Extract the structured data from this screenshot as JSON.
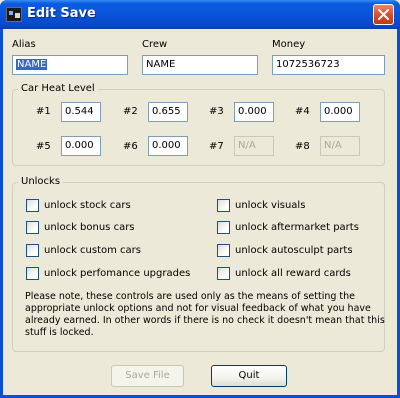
{
  "window": {
    "title": "Edit Save",
    "app_icon": "nfs-app-icon",
    "close_icon": "close-icon",
    "close_color": "#d9512c",
    "titlebar_color": "#0a54d8"
  },
  "alias": {
    "label": "Alias",
    "value": "NAME"
  },
  "crew": {
    "label": "Crew",
    "value": "NAME"
  },
  "money": {
    "label": "Money",
    "value": "1072536723"
  },
  "heat": {
    "title": "Car Heat Level",
    "items": [
      {
        "label": "#1",
        "value": "0.544",
        "enabled": true
      },
      {
        "label": "#2",
        "value": "0.655",
        "enabled": true
      },
      {
        "label": "#3",
        "value": "0.000",
        "enabled": true
      },
      {
        "label": "#4",
        "value": "0.000",
        "enabled": true
      },
      {
        "label": "#5",
        "value": "0.000",
        "enabled": true
      },
      {
        "label": "#6",
        "value": "0.000",
        "enabled": true
      },
      {
        "label": "#7",
        "value": "N/A",
        "enabled": false
      },
      {
        "label": "#8",
        "value": "N/A",
        "enabled": false
      }
    ]
  },
  "unlocks": {
    "title": "Unlocks",
    "items": [
      {
        "label": "unlock stock cars",
        "checked": false
      },
      {
        "label": "unlock visuals",
        "checked": false
      },
      {
        "label": "unlock bonus cars",
        "checked": false
      },
      {
        "label": "unlock aftermarket parts",
        "checked": false
      },
      {
        "label": "unlock custom cars",
        "checked": false
      },
      {
        "label": "unlock autosculpt parts",
        "checked": false
      },
      {
        "label": "unlock perfomance upgrades",
        "checked": false
      },
      {
        "label": "unlock all reward cards",
        "checked": false
      }
    ],
    "note": "Please note, these controls are used only as the means of setting the appropriate unlock options and not for visual feedback of what you have already earned. In other words if there is no check it doesn't mean that this stuff is locked."
  },
  "buttons": {
    "save_label": "Save File",
    "save_enabled": false,
    "quit_label": "Quit"
  }
}
